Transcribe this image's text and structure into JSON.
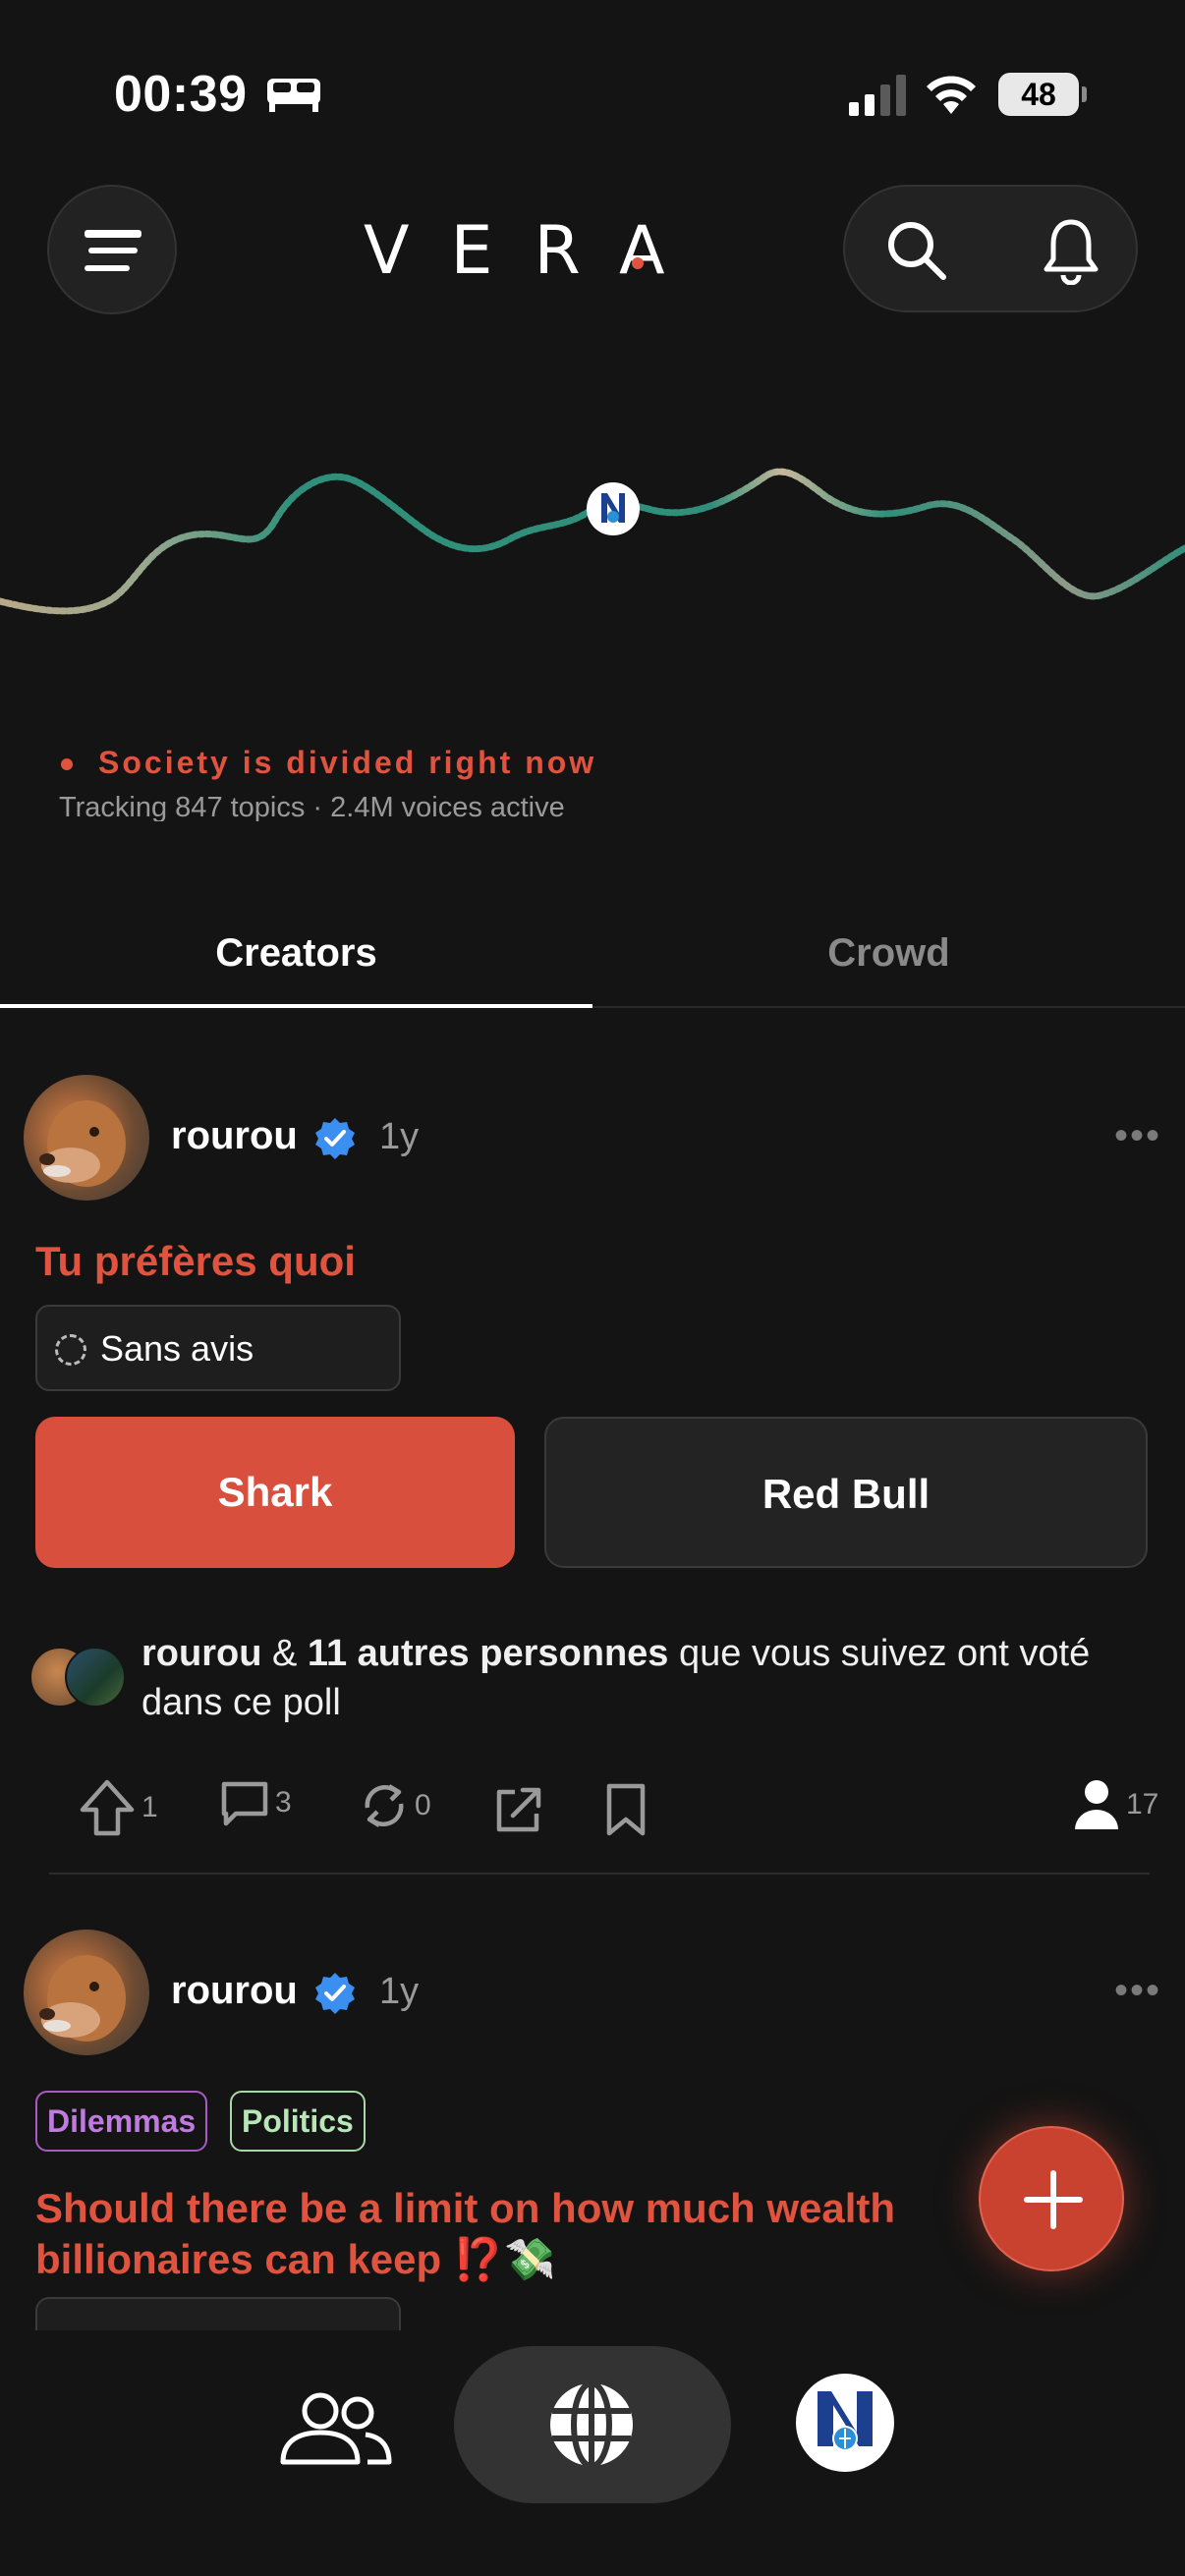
{
  "status_bar": {
    "time": "00:39",
    "battery": "48"
  },
  "header": {
    "logo": "VERA"
  },
  "hero": {
    "headline": "Society is divided right now",
    "subline": "Tracking 847 topics · 2.4M voices active"
  },
  "tabs": [
    {
      "label": "Creators",
      "active": true
    },
    {
      "label": "Crowd",
      "active": false
    }
  ],
  "post1": {
    "username": "rourou",
    "age": "1y",
    "more": "•••",
    "question": "Tu préfères quoi",
    "no_opinion": "Sans avis",
    "option_a": "Shark",
    "option_b": "Red Bull",
    "voters_bold_1": "rourou",
    "voters_amp": " & ",
    "voters_bold_2": "11 autres personnes",
    "voters_rest": " que vous suivez ont voté dans ce poll",
    "upvotes": "1",
    "comments": "3",
    "reposts": "0",
    "participants": "17"
  },
  "post2": {
    "username": "rourou",
    "age": "1y",
    "more": "•••",
    "tags": [
      "Dilemmas",
      "Politics"
    ],
    "question": "Should there be a limit on how much wealth billionaires can keep ⁉️💸"
  },
  "colors": {
    "accent": "#e0533f",
    "background": "#141414",
    "verified": "#3b8ff0"
  }
}
